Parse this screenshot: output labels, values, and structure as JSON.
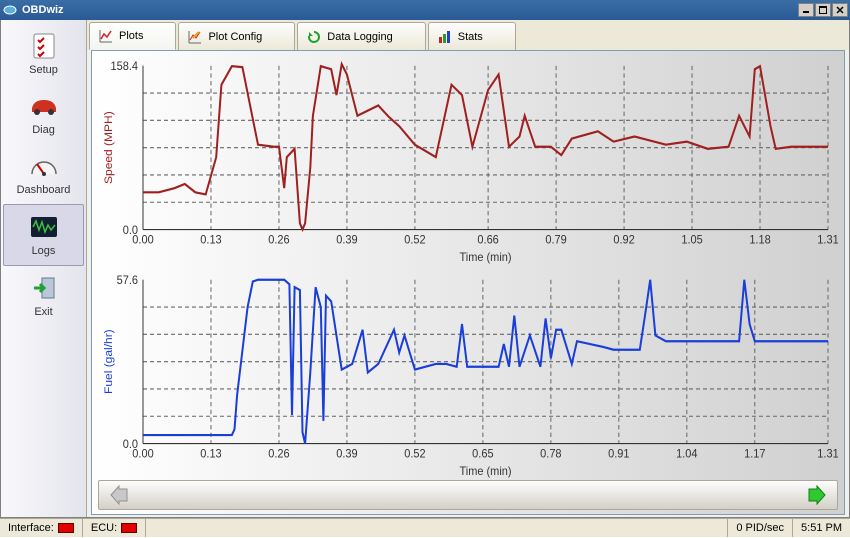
{
  "window": {
    "title": "OBDwiz"
  },
  "sidebar": {
    "items": [
      {
        "label": "Setup",
        "icon": "check-list-icon"
      },
      {
        "label": "Diag",
        "icon": "car-icon"
      },
      {
        "label": "Dashboard",
        "icon": "gauge-icon"
      },
      {
        "label": "Logs",
        "icon": "waveform-icon"
      },
      {
        "label": "Exit",
        "icon": "exit-door-icon"
      }
    ],
    "selected_index": 3
  },
  "tabs": {
    "items": [
      {
        "label": "Plots",
        "icon": "chart-icon"
      },
      {
        "label": "Plot Config",
        "icon": "chart-config-icon"
      },
      {
        "label": "Data Logging",
        "icon": "refresh-icon"
      },
      {
        "label": "Stats",
        "icon": "stats-icon"
      }
    ],
    "active_index": 0
  },
  "status": {
    "interface_label": "Interface:",
    "ecu_label": "ECU:",
    "pid_rate": "0 PID/sec",
    "clock": "5:51 PM"
  },
  "chart_data": [
    {
      "type": "line",
      "title": "",
      "xlabel": "Time (min)",
      "ylabel": "Speed (MPH)",
      "color": "#a02020",
      "xlim": [
        0.0,
        1.31
      ],
      "ylim": [
        0.0,
        158.4
      ],
      "xticks": [
        0.0,
        0.13,
        0.26,
        0.39,
        0.52,
        0.66,
        0.79,
        0.92,
        1.05,
        1.18,
        1.31
      ],
      "yticks": [
        0.0,
        158.4
      ],
      "x": [
        0.0,
        0.03,
        0.06,
        0.08,
        0.1,
        0.12,
        0.14,
        0.15,
        0.17,
        0.19,
        0.22,
        0.25,
        0.26,
        0.27,
        0.275,
        0.29,
        0.3,
        0.305,
        0.31,
        0.32,
        0.325,
        0.34,
        0.36,
        0.37,
        0.38,
        0.39,
        0.41,
        0.45,
        0.47,
        0.49,
        0.52,
        0.56,
        0.59,
        0.61,
        0.63,
        0.66,
        0.68,
        0.7,
        0.72,
        0.73,
        0.75,
        0.78,
        0.8,
        0.82,
        0.87,
        0.9,
        0.94,
        1.0,
        1.04,
        1.08,
        1.12,
        1.14,
        1.15,
        1.16,
        1.17,
        1.18,
        1.2,
        1.21,
        1.24,
        1.31
      ],
      "values": [
        36,
        36,
        40,
        44,
        36,
        34,
        70,
        140,
        158,
        157,
        82,
        80,
        80,
        40,
        70,
        78,
        6,
        0,
        6,
        60,
        110,
        158,
        155,
        130,
        160,
        150,
        110,
        120,
        109,
        100,
        82,
        70,
        140,
        130,
        80,
        135,
        150,
        80,
        90,
        110,
        80,
        80,
        72,
        88,
        95,
        85,
        90,
        82,
        85,
        78,
        80,
        110,
        100,
        90,
        155,
        158,
        100,
        78,
        80,
        80
      ]
    },
    {
      "type": "line",
      "title": "",
      "xlabel": "Time (min)",
      "ylabel": "Fuel (gal/hr)",
      "color": "#1a3fd8",
      "xlim": [
        0.0,
        1.31
      ],
      "ylim": [
        0.0,
        57.6
      ],
      "xticks": [
        0.0,
        0.13,
        0.26,
        0.39,
        0.52,
        0.65,
        0.78,
        0.91,
        1.04,
        1.17,
        1.31
      ],
      "yticks": [
        0.0,
        57.6
      ],
      "x": [
        0.0,
        0.17,
        0.175,
        0.18,
        0.2,
        0.21,
        0.22,
        0.27,
        0.28,
        0.285,
        0.29,
        0.3,
        0.305,
        0.31,
        0.32,
        0.33,
        0.34,
        0.345,
        0.35,
        0.36,
        0.38,
        0.4,
        0.42,
        0.43,
        0.45,
        0.48,
        0.49,
        0.5,
        0.52,
        0.56,
        0.58,
        0.6,
        0.61,
        0.62,
        0.68,
        0.69,
        0.7,
        0.71,
        0.72,
        0.74,
        0.76,
        0.77,
        0.78,
        0.79,
        0.8,
        0.82,
        0.83,
        0.88,
        0.9,
        0.93,
        0.95,
        0.96,
        0.97,
        0.98,
        1.0,
        1.1,
        1.13,
        1.14,
        1.15,
        1.16,
        1.17,
        1.2,
        1.31
      ],
      "values": [
        3,
        3,
        5,
        17,
        48,
        57,
        57.6,
        57.6,
        56,
        10,
        55,
        54,
        4,
        0,
        25,
        55,
        48,
        8,
        52,
        50,
        26,
        28,
        40,
        25,
        28,
        40,
        32,
        38,
        26,
        28,
        28,
        27,
        42,
        27,
        27,
        35,
        27,
        45,
        27,
        38,
        27,
        44,
        30,
        40,
        40,
        28,
        36,
        34,
        33,
        33,
        33,
        45,
        57.6,
        38,
        36,
        36,
        36,
        36,
        57.6,
        42,
        36,
        36,
        36
      ]
    }
  ]
}
